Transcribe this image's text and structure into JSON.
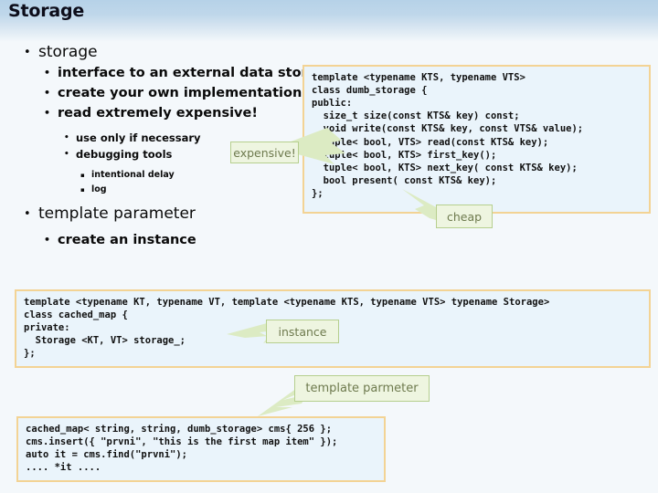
{
  "slide": {
    "title": "Storage",
    "background_color": "#f4f8fb",
    "header_gradient_top": "#b6d2e8",
    "header_gradient_bottom": "#f4f8fb"
  },
  "outline": {
    "items": [
      {
        "level": 1,
        "marker": "•",
        "text": "storage"
      },
      {
        "level": 2,
        "marker": "•",
        "text": "interface to an external data store"
      },
      {
        "level": 2,
        "marker": "•",
        "text": "create your own implementation"
      },
      {
        "level": 2,
        "marker": "•",
        "text": "read extremely expensive!"
      },
      {
        "level": 3,
        "marker": "•",
        "text": "use only if necessary"
      },
      {
        "level": 3,
        "marker": "•",
        "text": "debugging tools"
      },
      {
        "level": 4,
        "marker": "▪",
        "text": "intentional delay"
      },
      {
        "level": 4,
        "marker": "▪",
        "text": "log"
      },
      {
        "level": 1,
        "marker": "•",
        "text": "template parameter"
      },
      {
        "level": 2,
        "marker": "•",
        "text": "create an instance"
      }
    ]
  },
  "code_blocks": {
    "storage_interface": {
      "border_color": "#f3d394",
      "background_color": "#eaf4fb",
      "text": "template <typename KTS, typename VTS>\nclass dumb_storage {\npublic:\n  size_t size(const KTS& key) const;\n  void write(const KTS& key, const VTS& value);\n  tuple< bool, VTS> read(const KTS& key);\n  tuple< bool, KTS> first_key();\n  tuple< bool, KTS> next_key( const KTS& key);\n  bool present( const KTS& key);\n};"
    },
    "cached_map": {
      "border_color": "#f3d394",
      "background_color": "#eaf4fb",
      "text": "template <typename KT, typename VT, template <typename KTS, typename VTS> typename Storage>\nclass cached_map {\nprivate:\n  Storage <KT, VT> storage_;\n};"
    },
    "usage": {
      "border_color": "#f3d394",
      "background_color": "#eaf4fb",
      "text": "cached_map< string, string, dumb_storage> cms{ 256 };\ncms.insert({ \"prvni\", \"this is the first map item\" });\nauto it = cms.find(\"prvni\");\n.... *it ...."
    }
  },
  "callouts": {
    "expensive": {
      "text": "expensive!",
      "fill": "#eef5e0",
      "border": "#b6cf8e",
      "text_color": "#6e7a4e"
    },
    "cheap": {
      "text": "cheap",
      "fill": "#eef5e0",
      "border": "#b6cf8e",
      "text_color": "#6e7a4e"
    },
    "instance": {
      "text": "instance",
      "fill": "#eef5e0",
      "border": "#b6cf8e",
      "text_color": "#6e7a4e"
    },
    "template_parameter": {
      "text": "template parmeter",
      "fill": "#eef5e0",
      "border": "#b6cf8e",
      "text_color": "#6e7a4e"
    }
  }
}
